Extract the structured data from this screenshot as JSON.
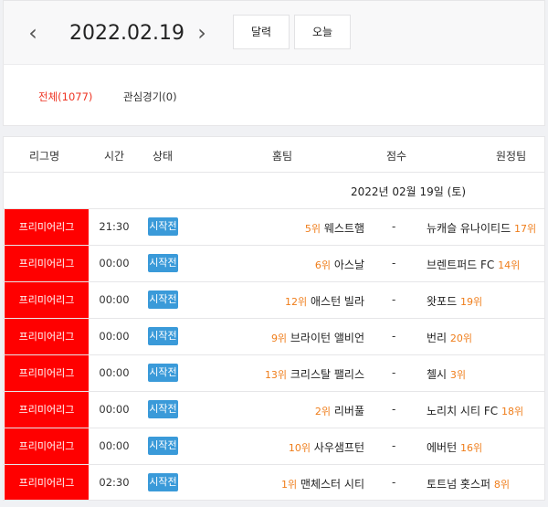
{
  "header": {
    "date": "2022.02.19",
    "prev_icon": "‹",
    "next_icon": "›",
    "calendar_label": "달력",
    "today_label": "오늘"
  },
  "filters": {
    "all": "전체(1077)",
    "favorites": "관심경기(0)"
  },
  "table": {
    "columns": [
      "리그명",
      "시간",
      "상태",
      "홈팀",
      "점수",
      "원정팀"
    ],
    "date_heading": "2022년 02월 19일 (토)",
    "rows": [
      {
        "league": "프리미어리그",
        "time": "21:30",
        "status": "시작전",
        "home_rank": "5위",
        "home": "웨스트햄",
        "score": "-",
        "away": "뉴캐슬 유나이티드",
        "away_rank": "17위"
      },
      {
        "league": "프리미어리그",
        "time": "00:00",
        "status": "시작전",
        "home_rank": "6위",
        "home": "아스날",
        "score": "-",
        "away": "브렌트퍼드 FC",
        "away_rank": "14위"
      },
      {
        "league": "프리미어리그",
        "time": "00:00",
        "status": "시작전",
        "home_rank": "12위",
        "home": "애스턴 빌라",
        "score": "-",
        "away": "왓포드",
        "away_rank": "19위"
      },
      {
        "league": "프리미어리그",
        "time": "00:00",
        "status": "시작전",
        "home_rank": "9위",
        "home": "브라이턴 앨비언",
        "score": "-",
        "away": "번리",
        "away_rank": "20위"
      },
      {
        "league": "프리미어리그",
        "time": "00:00",
        "status": "시작전",
        "home_rank": "13위",
        "home": "크리스탈 팰리스",
        "score": "-",
        "away": "첼시",
        "away_rank": "3위"
      },
      {
        "league": "프리미어리그",
        "time": "00:00",
        "status": "시작전",
        "home_rank": "2위",
        "home": "리버풀",
        "score": "-",
        "away": "노리치 시티 FC",
        "away_rank": "18위"
      },
      {
        "league": "프리미어리그",
        "time": "00:00",
        "status": "시작전",
        "home_rank": "10위",
        "home": "사우샘프턴",
        "score": "-",
        "away": "에버턴",
        "away_rank": "16위"
      },
      {
        "league": "프리미어리그",
        "time": "02:30",
        "status": "시작전",
        "home_rank": "1위",
        "home": "맨체스터 시티",
        "score": "-",
        "away": "토트넘 홋스퍼",
        "away_rank": "8위"
      }
    ]
  },
  "colors": {
    "accent": "#ee3322",
    "league_bg": "#ff0000",
    "status_bg": "#3a9ad9",
    "rank": "#ef7d1a"
  }
}
